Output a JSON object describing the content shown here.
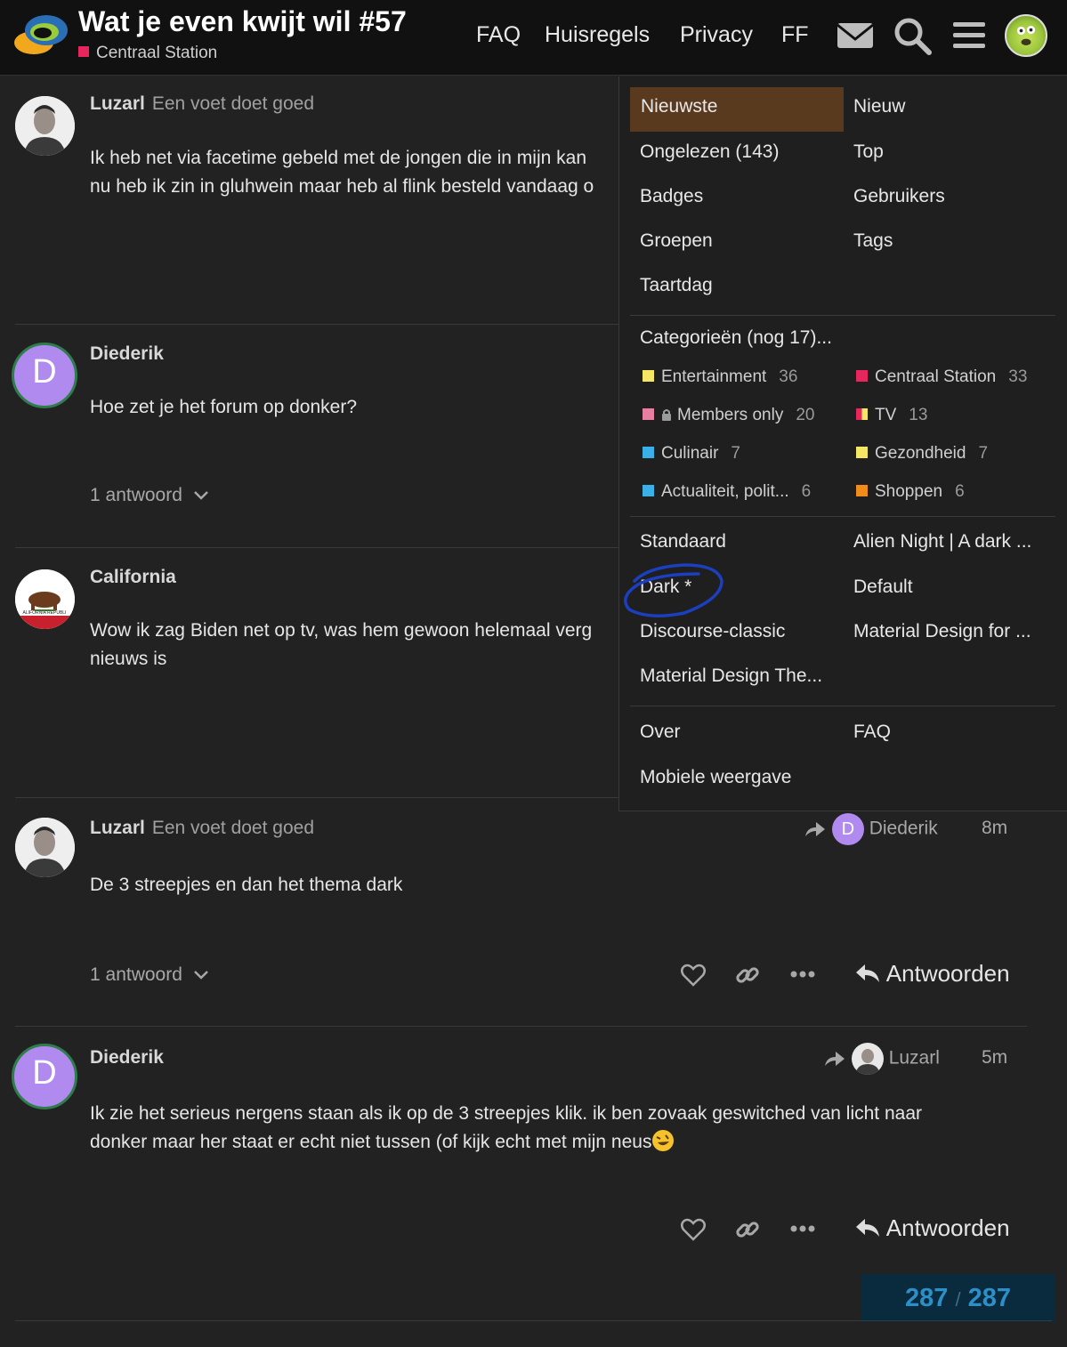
{
  "header": {
    "title": "Wat je even kwijt wil #57",
    "category": "Centraal Station",
    "category_color": "#e8265e",
    "nav": [
      "FAQ",
      "Huisregels",
      "Privacy",
      "FF"
    ],
    "icons": [
      "envelope-icon",
      "search-icon",
      "hamburger-icon",
      "user-avatar"
    ]
  },
  "posts": [
    {
      "username": "Luzarl",
      "user_title": "Een voet doet goed",
      "lines": [
        "Ik heb net via facetime gebeld met de jongen die in mijn kan",
        "nu heb ik zin in gluhwein maar heb al flink besteld vandaag o"
      ]
    },
    {
      "username": "Diederik",
      "avatar_letter": "D",
      "lines": [
        "Hoe zet je het forum op donker?"
      ],
      "replies": "1 antwoord"
    },
    {
      "username": "California",
      "lines": [
        "Wow ik zag Biden net op tv, was hem gewoon helemaal verg",
        "nieuws is"
      ]
    },
    {
      "username": "Luzarl",
      "user_title": "Een voet doet goed",
      "reply_to_letter": "D",
      "reply_to": "Diederik",
      "time": "8m",
      "lines": [
        "De 3 streepjes en dan het thema dark"
      ],
      "replies": "1 antwoord",
      "reply_label": "Antwoorden"
    },
    {
      "username": "Diederik",
      "avatar_letter": "D",
      "reply_to": "Luzarl",
      "time": "5m",
      "lines": [
        "Ik zie het serieus nergens staan als ik op de 3 streepjes klik. ik ben zovaak geswitched van licht naar",
        "donker maar her staat er echt niet tussen (of kijk echt met mijn neus"
      ],
      "reply_label": "Antwoorden"
    }
  ],
  "menu": {
    "items": [
      "Nieuwste",
      "Nieuw",
      "Ongelezen (143)",
      "Top",
      "Badges",
      "Gebruikers",
      "Groepen",
      "Tags",
      "Taartdag"
    ],
    "categories_header": "Categorieën (nog 17)...",
    "categories": [
      {
        "name": "Entertainment",
        "count": "36",
        "color": "#f5e663"
      },
      {
        "name": "Centraal Station",
        "count": "33",
        "color": "#e8265e"
      },
      {
        "name": "Members only",
        "count": "20",
        "color": "#e87ea1"
      },
      {
        "name": "TV",
        "count": "13",
        "color": "#e6c32f"
      },
      {
        "name": "Culinair",
        "count": "7",
        "color": "#3ab0e8"
      },
      {
        "name": "Gezondheid",
        "count": "7",
        "color": "#f5e663"
      },
      {
        "name": "Actualiteit, polit...",
        "count": "6",
        "color": "#3ab0e8"
      },
      {
        "name": "Shoppen",
        "count": "6",
        "color": "#f08c1a"
      }
    ],
    "themes": [
      "Standaard",
      "Alien Night | A dark ...",
      "Dark *",
      "Default",
      "Discourse-classic",
      "Material Design for ...",
      "Material Design The..."
    ],
    "footer": [
      "Over",
      "FAQ",
      "Mobiele weergave"
    ]
  },
  "progress": {
    "current": "287",
    "total": "287"
  }
}
